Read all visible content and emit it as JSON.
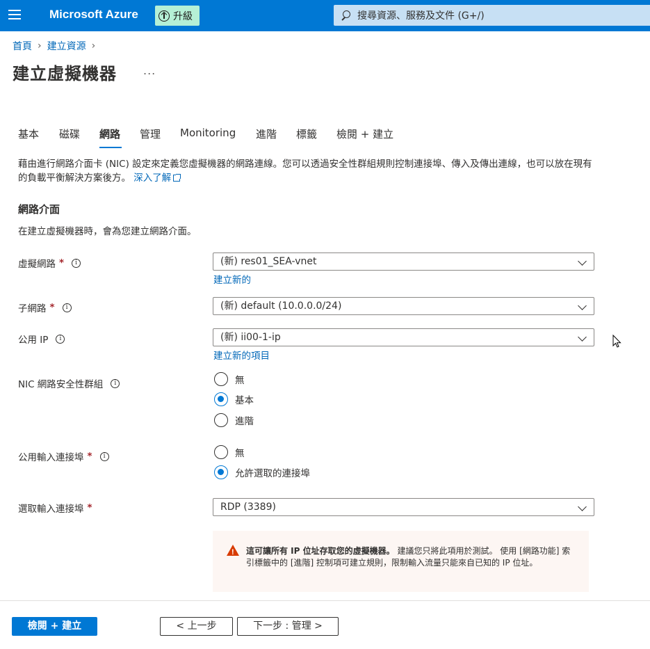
{
  "topbar": {
    "brand": "Microsoft Azure",
    "upgrade_label": "升級",
    "search_placeholder": "搜尋資源、服務及文件 (G+/)"
  },
  "breadcrumb": {
    "home": "首頁",
    "create_resource": "建立資源"
  },
  "page": {
    "title": "建立虛擬機器",
    "more": "..."
  },
  "tabs": [
    {
      "label": "基本"
    },
    {
      "label": "磁碟"
    },
    {
      "label": "網路"
    },
    {
      "label": "管理"
    },
    {
      "label": "Monitoring"
    },
    {
      "label": "進階"
    },
    {
      "label": "標籤"
    },
    {
      "label": "檢閱 + 建立"
    }
  ],
  "description": {
    "text": "藉由進行網路介面卡 (NIC) 設定來定義您虛擬機器的網路連線。您可以透過安全性群組規則控制連接埠、傳入及傳出連線，也可以放在現有的負載平衡解決方案後方。",
    "learn_more": "深入了解"
  },
  "section": {
    "title": "網路介面",
    "subtitle": "在建立虛擬機器時，會為您建立網路介面。"
  },
  "fields": {
    "vnet": {
      "label": "虛擬網路",
      "value": "(新) res01_SEA-vnet",
      "link": "建立新的"
    },
    "subnet": {
      "label": "子網路",
      "value": "(新) default (10.0.0.0/24)"
    },
    "public_ip": {
      "label": "公用 IP",
      "value": "(新) ii00-1-ip",
      "link": "建立新的項目"
    },
    "nsg": {
      "label": "NIC 網路安全性群組",
      "options": [
        "無",
        "基本",
        "進階"
      ],
      "selected": "基本"
    },
    "inbound_ports": {
      "label": "公用輸入連接埠",
      "options": [
        "無",
        "允許選取的連接埠"
      ],
      "selected": "允許選取的連接埠"
    },
    "select_ports": {
      "label": "選取輸入連接埠",
      "value": "RDP (3389)"
    }
  },
  "required_mark": "*",
  "info_glyph": "i",
  "warning": {
    "bold": "這可讓所有 IP 位址存取您的虛擬機器。",
    "text": " 建議您只將此項用於測試。 使用 [網路功能] 索引標籤中的 [進階] 控制項可建立規則，限制輸入流量只能來自已知的 IP 位址。"
  },
  "footer": {
    "review_create": "檢閱 + 建立",
    "previous": "< 上一步",
    "next": "下一步 : 管理 >"
  },
  "colors": {
    "brand_blue": "#0078d4",
    "link_blue": "#0067b8",
    "required_red": "#a4262c",
    "warning_orange": "#d83b01",
    "upgrade_green": "#b5f0d6"
  }
}
